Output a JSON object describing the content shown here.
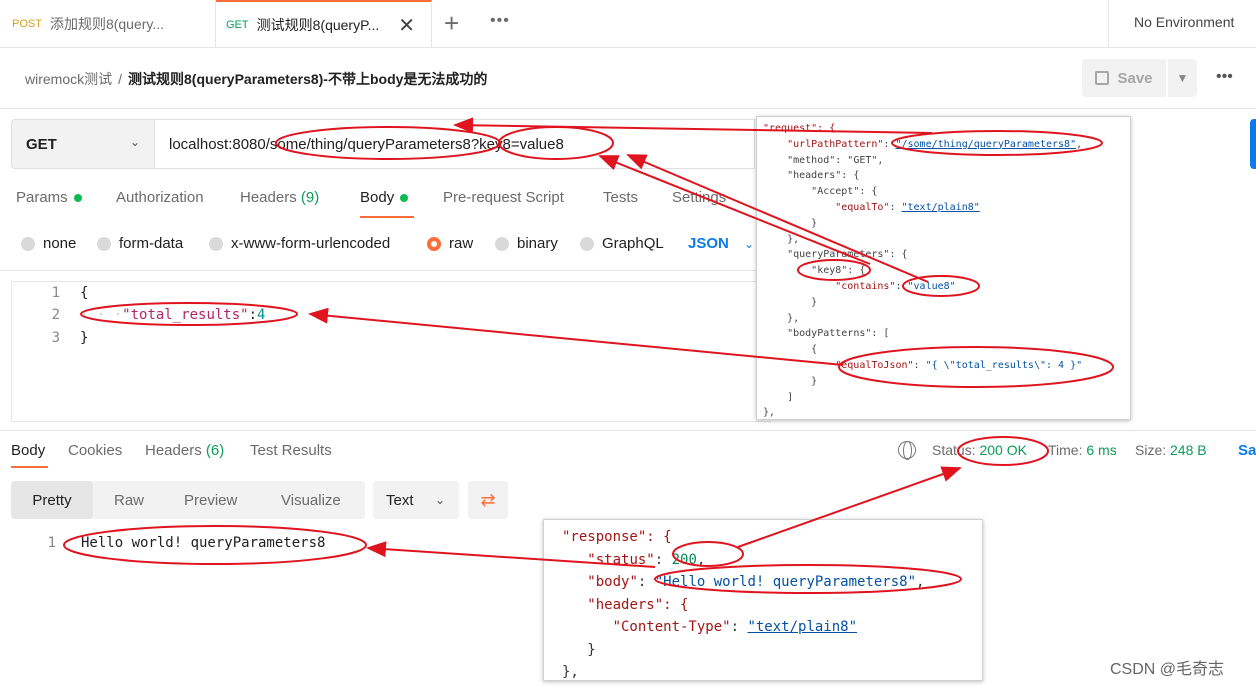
{
  "tabs": [
    {
      "method": "POST",
      "title": "添加规则8(query..."
    },
    {
      "method": "GET",
      "title": "测试规则8(queryP..."
    }
  ],
  "tab_close": "✕",
  "new_tab": "+",
  "more": "•••",
  "environment": "No Environment",
  "breadcrumb": {
    "parent": "wiremock测试",
    "sep": "/",
    "current": "测试规则8(queryParameters8)-不带上body是无法成功的"
  },
  "save_label": "Save",
  "request": {
    "method": "GET",
    "url": "localhost:8080/some/thing/queryParameters8?key8=value8"
  },
  "request_tabs": {
    "params": "Params",
    "authorization": "Authorization",
    "headers": "Headers",
    "headers_count": "(9)",
    "body": "Body",
    "prerequest": "Pre-request Script",
    "tests": "Tests",
    "settings": "Settings"
  },
  "body_modes": [
    "none",
    "form-data",
    "x-www-form-urlencoded",
    "raw",
    "binary",
    "GraphQL"
  ],
  "body_format": "JSON",
  "editor": {
    "line_numbers": [
      "1",
      "2",
      "3"
    ],
    "open": "{",
    "indent": "· · ·",
    "key": "\"total_results\"",
    "colon": ":",
    "value": "4",
    "close": "}"
  },
  "response_tabs": {
    "body": "Body",
    "cookies": "Cookies",
    "headers": "Headers",
    "headers_count": "(6)",
    "test_results": "Test Results"
  },
  "status": {
    "label": "Status:",
    "value": "200 OK"
  },
  "time": {
    "label": "Time:",
    "value": "6 ms"
  },
  "size": {
    "label": "Size:",
    "value": "248 B"
  },
  "save_as": "Sa",
  "view_modes": [
    "Pretty",
    "Raw",
    "Preview",
    "Visualize"
  ],
  "format_select": "Text",
  "response_body": {
    "line": "1",
    "text": "Hello world! queryParameters8"
  },
  "req_mapping_code": {
    "l1": "\"request\": {",
    "l2_key": "\"urlPathPattern\"",
    "l2_val": "\"/some/thing/queryParameters8\"",
    "l3": "\"method\": \"GET\",",
    "l4": "\"headers\": {",
    "l5": "\"Accept\": {",
    "l6_key": "\"equalTo\"",
    "l6_val": "\"text/plain8\"",
    "l7": "}",
    "l8": "},",
    "l9": "\"queryParameters\": {",
    "l10": "\"key8\": {",
    "l11_key": "\"contains\"",
    "l11_val": "\"value8\"",
    "l12": "}",
    "l13": "},",
    "l14": "\"bodyPatterns\": [",
    "l15": "{",
    "l16_key": "\"equalToJson\"",
    "l16_val": "\"{ \\\"total_results\\\": 4 }\"",
    "l17": "}",
    "l18": "]",
    "l19": "},"
  },
  "resp_mapping_code": {
    "l1": "\"response\": {",
    "l2_key": "\"status\"",
    "l2_val": "200",
    "l3_key": "\"body\"",
    "l3_val": "\"Hello world! queryParameters8\"",
    "l4": "\"headers\": {",
    "l5_key": "\"Content-Type\"",
    "l5_val": "\"text/plain8\"",
    "l6": "}",
    "l7": "},"
  },
  "watermark": "CSDN @毛奇志",
  "colors": {
    "accent": "#ff6c37",
    "annotation": "#e0141e",
    "success": "#0c9b5a",
    "link": "#097bed"
  }
}
